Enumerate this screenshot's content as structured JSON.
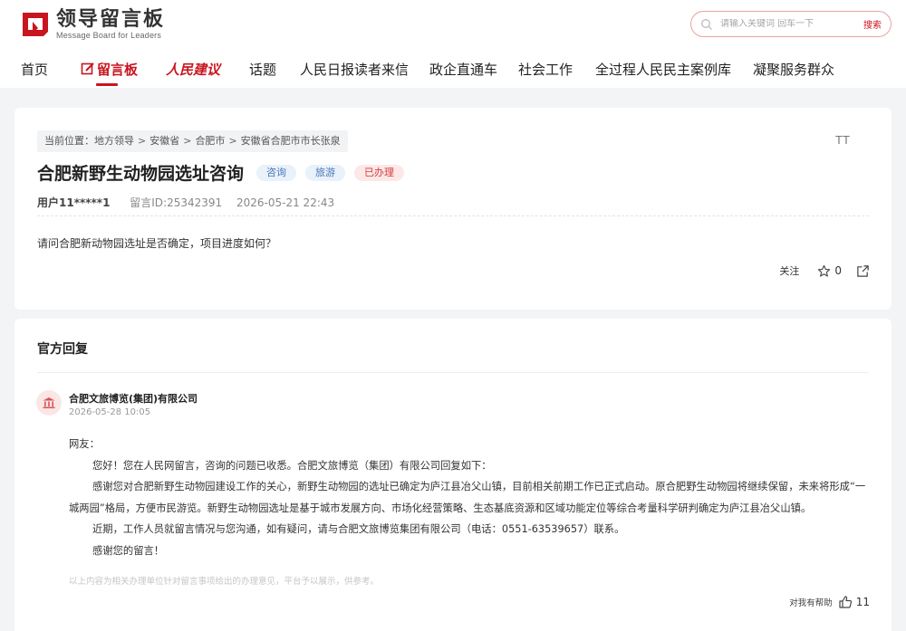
{
  "header": {
    "logo_title": "领导留言板",
    "logo_subtitle": "Message Board for Leaders",
    "search_placeholder": "请输入关键词 回车一下",
    "search_button": "搜索"
  },
  "nav": {
    "items": [
      {
        "label": "首页"
      },
      {
        "label": "留言板",
        "active": true
      },
      {
        "label": "人民建议"
      },
      {
        "label": "话题"
      },
      {
        "label": "人民日报读者来信"
      },
      {
        "label": "政企直通车"
      },
      {
        "label": "社会工作"
      },
      {
        "label": "全过程人民民主案例库"
      },
      {
        "label": "凝聚服务群众"
      }
    ]
  },
  "message": {
    "breadcrumb": {
      "prefix": "当前位置：",
      "items": [
        "地方领导",
        "安徽省",
        "合肥市",
        "安徽省合肥市市长张泉"
      ],
      "separator": ">"
    },
    "font_size_label": "TT",
    "title": "合肥新野生动物园选址咨询",
    "tags": [
      "咨询",
      "旅游",
      "已办理"
    ],
    "user": "用户11*****1",
    "message_id": "留言ID:25342391",
    "datetime": "2026-05-21 22:43",
    "content": "请问合肥新动物园选址是否确定，项目进度如何？",
    "follow_label": "关注",
    "like_count": "0"
  },
  "reply": {
    "heading": "官方回复",
    "org_name": "合肥文旅博览(集团)有限公司",
    "time": "2026-05-28 10:05",
    "paragraphs": [
      "网友：",
      "您好！您在人民网留言，咨询的问题已收悉。合肥文旅博览（集团）有限公司回复如下：",
      "感谢您对合肥新野生动物园建设工作的关心，新野生动物园的选址已确定为庐江县冶父山镇，目前相关前期工作已正式启动。原合肥野生动物园将继续保留，未来将形成“一城两园”格局，方便市民游览。新野生动物园选址是基于城市发展方向、市场化经营策略、生态基底资源和区域功能定位等综合考量科学研判确定为庐江县冶父山镇。",
      "近期，工作人员就留言情况与您沟通，如有疑问，请与合肥文旅博览集团有限公司（电话：0551-63539657）联系。",
      "感谢您的留言！"
    ],
    "note": "以上内容为相关办理单位针对留言事项给出的办理意见，平台予以展示，供参考。",
    "helpful_label": "对我有帮助",
    "helpful_count": "11"
  },
  "colors": {
    "brand_red": "#c9151e",
    "tag_blue_bg": "#e9f1fb",
    "tag_red_bg": "#fde8e8"
  }
}
